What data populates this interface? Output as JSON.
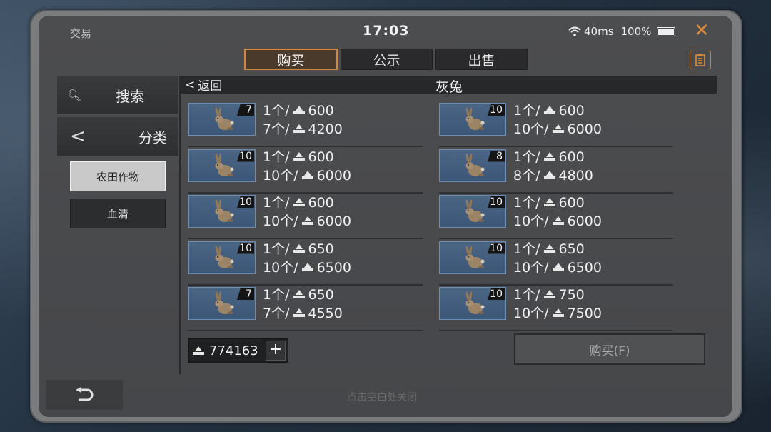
{
  "window": {
    "title": "交易",
    "time": "17:03",
    "ping": "40ms",
    "battery": "100%"
  },
  "tabs": [
    {
      "label": "购买",
      "active": true
    },
    {
      "label": "公示"
    },
    {
      "label": "出售"
    }
  ],
  "sidebar": {
    "search_label": "搜索",
    "category_label": "分类",
    "sub_items": [
      "农田作物",
      "血清"
    ]
  },
  "header": {
    "back_label": "返回",
    "item_name": "灰兔"
  },
  "listings": [
    {
      "qty": "7",
      "unit": "1个/",
      "unit_price": "600",
      "total_label": "7个/",
      "total": "4200"
    },
    {
      "qty": "10",
      "unit": "1个/",
      "unit_price": "600",
      "total_label": "10个/",
      "total": "6000"
    },
    {
      "qty": "10",
      "unit": "1个/",
      "unit_price": "600",
      "total_label": "10个/",
      "total": "6000"
    },
    {
      "qty": "8",
      "unit": "1个/",
      "unit_price": "600",
      "total_label": "8个/",
      "total": "4800"
    },
    {
      "qty": "10",
      "unit": "1个/",
      "unit_price": "600",
      "total_label": "10个/",
      "total": "6000"
    },
    {
      "qty": "10",
      "unit": "1个/",
      "unit_price": "600",
      "total_label": "10个/",
      "total": "6000"
    },
    {
      "qty": "10",
      "unit": "1个/",
      "unit_price": "650",
      "total_label": "10个/",
      "total": "6500"
    },
    {
      "qty": "10",
      "unit": "1个/",
      "unit_price": "650",
      "total_label": "10个/",
      "total": "6500"
    },
    {
      "qty": "7",
      "unit": "1个/",
      "unit_price": "650",
      "total_label": "7个/",
      "total": "4550"
    },
    {
      "qty": "10",
      "unit": "1个/",
      "unit_price": "750",
      "total_label": "10个/",
      "total": "7500"
    }
  ],
  "footer": {
    "balance": "774163",
    "buy_label": "购买(F)",
    "hint": "点击空白处关闭"
  },
  "colors": {
    "accent": "#d1873d",
    "panel": "#4a4b4d",
    "thumb": "#4b6585"
  },
  "icons": {
    "currency": "coin-pile-icon",
    "close": "close-icon",
    "search": "search-icon",
    "undo": "undo-icon"
  }
}
